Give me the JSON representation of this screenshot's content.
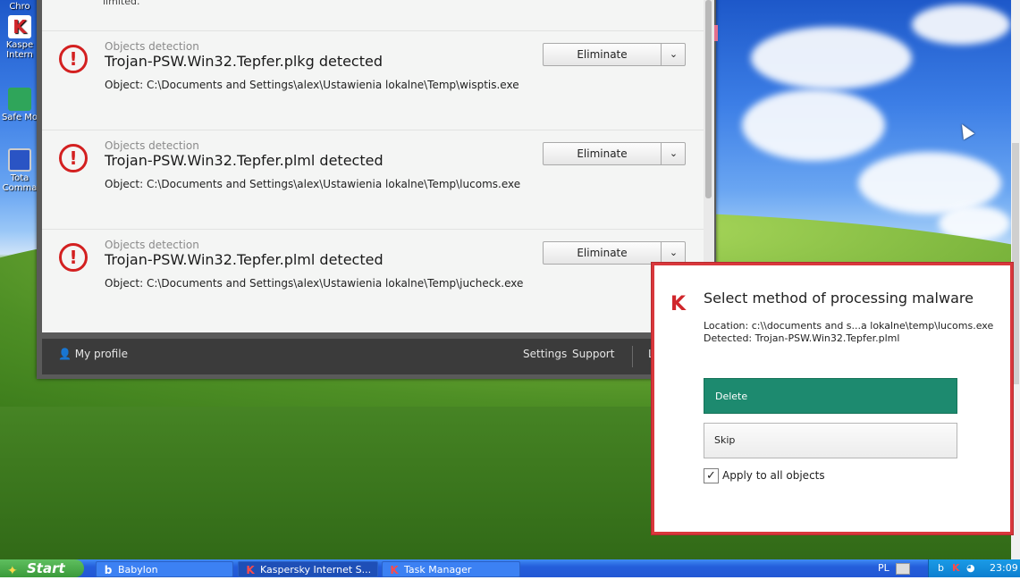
{
  "desktop": {
    "icons": [
      {
        "label": "Chro",
        "icon": "chrome-icon"
      },
      {
        "label": "Kaspe Intern",
        "icon": "kaspersky-icon"
      },
      {
        "label": "Safe Mo",
        "icon": "safe-money-icon"
      },
      {
        "label": "Tota Comma",
        "icon": "total-commander-icon"
      }
    ]
  },
  "kaspersky": {
    "partial_text": "limited.",
    "detections": [
      {
        "category": "Objects detection",
        "title": "Trojan-PSW.Win32.Tepfer.plkg detected",
        "object": "Object: C:\\Documents and Settings\\alex\\Ustawienia lokalne\\Temp\\wisptis.exe",
        "action": "Eliminate"
      },
      {
        "category": "Objects detection",
        "title": "Trojan-PSW.Win32.Tepfer.plml detected",
        "object": "Object: C:\\Documents and Settings\\alex\\Ustawienia lokalne\\Temp\\lucoms.exe",
        "action": "Eliminate"
      },
      {
        "category": "Objects detection",
        "title": "Trojan-PSW.Win32.Tepfer.plml detected",
        "object": "Object: C:\\Documents and Settings\\alex\\Ustawienia lokalne\\Temp\\jucheck.exe",
        "action": "Eliminate"
      }
    ],
    "footer": {
      "my_profile": "My profile",
      "settings": "Settings",
      "support": "Support",
      "truncated": "L"
    }
  },
  "popup": {
    "title": "Select method of processing malware",
    "location": "Location:  c:\\\\documents and s...a lokalne\\temp\\lucoms.exe",
    "detected": "Detected: Trojan-PSW.Win32.Tepfer.plml",
    "delete_label": "Delete",
    "skip_label": "Skip",
    "apply_all_label": "Apply to all objects",
    "apply_all_checked": true,
    "accent_color": "#1d8a6f",
    "border_color": "#d9373c"
  },
  "taskbar": {
    "start_label": "Start",
    "tasks": [
      {
        "label": "Babylon",
        "icon": "babylon-icon"
      },
      {
        "label": "Kaspersky Internet S...",
        "icon": "kaspersky-icon"
      },
      {
        "label": "Task Manager",
        "icon": "task-manager-icon"
      }
    ],
    "language": "PL",
    "clock": "23:09"
  }
}
